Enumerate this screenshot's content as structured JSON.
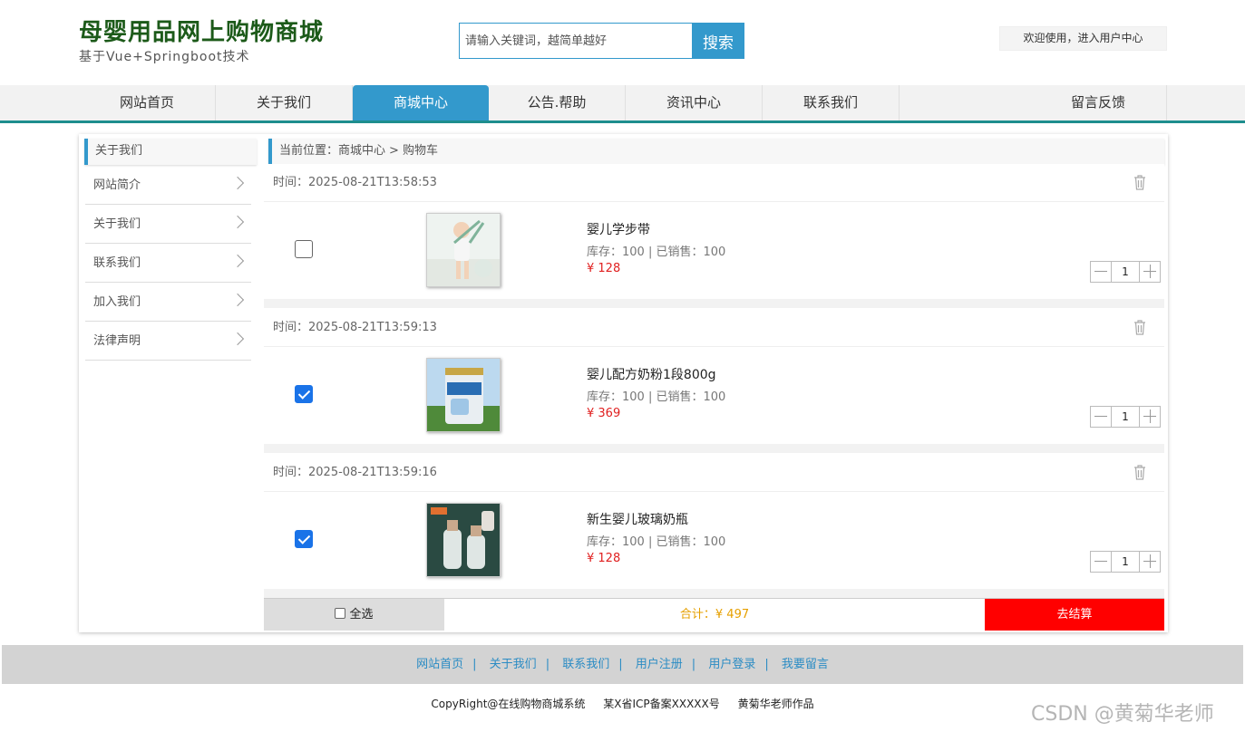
{
  "header": {
    "title": "母婴用品网上购物商城",
    "subtitle": "基于Vue+Springboot技术",
    "search_placeholder": "请输入关键词，越简单越好",
    "search_button": "搜索",
    "user_center": "欢迎使用，进入用户中心"
  },
  "nav": {
    "items": [
      "网站首页",
      "关于我们",
      "商城中心",
      "公告.帮助",
      "资讯中心",
      "联系我们",
      "留言反馈"
    ],
    "active_index": 2
  },
  "sidebar": {
    "heading": "关于我们",
    "items": [
      "网站简介",
      "关于我们",
      "联系我们",
      "加入我们",
      "法律声明"
    ]
  },
  "breadcrumb": {
    "prefix": "当前位置：",
    "path1": "商城中心",
    "sep": ">",
    "path2": "购物车"
  },
  "cart": {
    "time_label": "时间：",
    "items": [
      {
        "time": "2025-08-21T13:58:53",
        "checked": false,
        "name": "婴儿学步带",
        "stock": "库存：100 | 已销售：100",
        "price": "¥ 128",
        "qty": "1",
        "image_icon": "baby-walker-photo-icon"
      },
      {
        "time": "2025-08-21T13:59:13",
        "checked": true,
        "name": "婴儿配方奶粉1段800g",
        "stock": "库存：100 | 已销售：100",
        "price": "¥ 369",
        "qty": "1",
        "image_icon": "milk-powder-photo-icon"
      },
      {
        "time": "2025-08-21T13:59:16",
        "checked": true,
        "name": "新生婴儿玻璃奶瓶",
        "stock": "库存：100 | 已销售：100",
        "price": "¥ 128",
        "qty": "1",
        "image_icon": "baby-bottle-photo-icon"
      }
    ],
    "select_all": "全选",
    "total": "合计：¥ 497",
    "checkout": "去结算"
  },
  "footer": {
    "links": [
      "网站首页",
      "关于我们",
      "联系我们",
      "用户注册",
      "用户登录",
      "我要留言"
    ],
    "copyright": "CopyRight@在线购物商城系统",
    "icp": "某X省ICP备案XXXXX号",
    "author": "黄菊华老师作品",
    "watermark": "CSDN @黄菊华老师"
  },
  "colors": {
    "brand_green": "#1c5a19",
    "accent_blue": "#3399cc",
    "nav_underline": "#1e8e8e",
    "price_red": "#e02020",
    "checkout_red": "#ff0000",
    "total_orange": "#e6a000"
  }
}
